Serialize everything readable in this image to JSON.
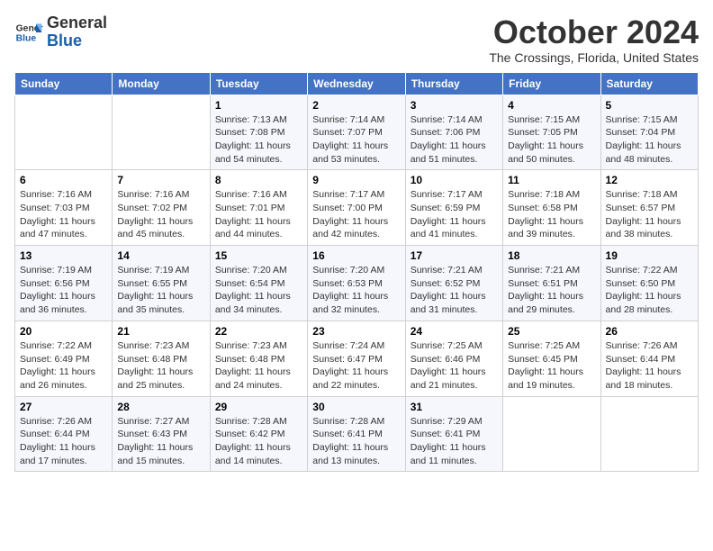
{
  "logo": {
    "general": "General",
    "blue": "Blue"
  },
  "title": "October 2024",
  "location": "The Crossings, Florida, United States",
  "headers": [
    "Sunday",
    "Monday",
    "Tuesday",
    "Wednesday",
    "Thursday",
    "Friday",
    "Saturday"
  ],
  "weeks": [
    [
      {
        "day": "",
        "info": ""
      },
      {
        "day": "",
        "info": ""
      },
      {
        "day": "1",
        "info": "Sunrise: 7:13 AM\nSunset: 7:08 PM\nDaylight: 11 hours and 54 minutes."
      },
      {
        "day": "2",
        "info": "Sunrise: 7:14 AM\nSunset: 7:07 PM\nDaylight: 11 hours and 53 minutes."
      },
      {
        "day": "3",
        "info": "Sunrise: 7:14 AM\nSunset: 7:06 PM\nDaylight: 11 hours and 51 minutes."
      },
      {
        "day": "4",
        "info": "Sunrise: 7:15 AM\nSunset: 7:05 PM\nDaylight: 11 hours and 50 minutes."
      },
      {
        "day": "5",
        "info": "Sunrise: 7:15 AM\nSunset: 7:04 PM\nDaylight: 11 hours and 48 minutes."
      }
    ],
    [
      {
        "day": "6",
        "info": "Sunrise: 7:16 AM\nSunset: 7:03 PM\nDaylight: 11 hours and 47 minutes."
      },
      {
        "day": "7",
        "info": "Sunrise: 7:16 AM\nSunset: 7:02 PM\nDaylight: 11 hours and 45 minutes."
      },
      {
        "day": "8",
        "info": "Sunrise: 7:16 AM\nSunset: 7:01 PM\nDaylight: 11 hours and 44 minutes."
      },
      {
        "day": "9",
        "info": "Sunrise: 7:17 AM\nSunset: 7:00 PM\nDaylight: 11 hours and 42 minutes."
      },
      {
        "day": "10",
        "info": "Sunrise: 7:17 AM\nSunset: 6:59 PM\nDaylight: 11 hours and 41 minutes."
      },
      {
        "day": "11",
        "info": "Sunrise: 7:18 AM\nSunset: 6:58 PM\nDaylight: 11 hours and 39 minutes."
      },
      {
        "day": "12",
        "info": "Sunrise: 7:18 AM\nSunset: 6:57 PM\nDaylight: 11 hours and 38 minutes."
      }
    ],
    [
      {
        "day": "13",
        "info": "Sunrise: 7:19 AM\nSunset: 6:56 PM\nDaylight: 11 hours and 36 minutes."
      },
      {
        "day": "14",
        "info": "Sunrise: 7:19 AM\nSunset: 6:55 PM\nDaylight: 11 hours and 35 minutes."
      },
      {
        "day": "15",
        "info": "Sunrise: 7:20 AM\nSunset: 6:54 PM\nDaylight: 11 hours and 34 minutes."
      },
      {
        "day": "16",
        "info": "Sunrise: 7:20 AM\nSunset: 6:53 PM\nDaylight: 11 hours and 32 minutes."
      },
      {
        "day": "17",
        "info": "Sunrise: 7:21 AM\nSunset: 6:52 PM\nDaylight: 11 hours and 31 minutes."
      },
      {
        "day": "18",
        "info": "Sunrise: 7:21 AM\nSunset: 6:51 PM\nDaylight: 11 hours and 29 minutes."
      },
      {
        "day": "19",
        "info": "Sunrise: 7:22 AM\nSunset: 6:50 PM\nDaylight: 11 hours and 28 minutes."
      }
    ],
    [
      {
        "day": "20",
        "info": "Sunrise: 7:22 AM\nSunset: 6:49 PM\nDaylight: 11 hours and 26 minutes."
      },
      {
        "day": "21",
        "info": "Sunrise: 7:23 AM\nSunset: 6:48 PM\nDaylight: 11 hours and 25 minutes."
      },
      {
        "day": "22",
        "info": "Sunrise: 7:23 AM\nSunset: 6:48 PM\nDaylight: 11 hours and 24 minutes."
      },
      {
        "day": "23",
        "info": "Sunrise: 7:24 AM\nSunset: 6:47 PM\nDaylight: 11 hours and 22 minutes."
      },
      {
        "day": "24",
        "info": "Sunrise: 7:25 AM\nSunset: 6:46 PM\nDaylight: 11 hours and 21 minutes."
      },
      {
        "day": "25",
        "info": "Sunrise: 7:25 AM\nSunset: 6:45 PM\nDaylight: 11 hours and 19 minutes."
      },
      {
        "day": "26",
        "info": "Sunrise: 7:26 AM\nSunset: 6:44 PM\nDaylight: 11 hours and 18 minutes."
      }
    ],
    [
      {
        "day": "27",
        "info": "Sunrise: 7:26 AM\nSunset: 6:44 PM\nDaylight: 11 hours and 17 minutes."
      },
      {
        "day": "28",
        "info": "Sunrise: 7:27 AM\nSunset: 6:43 PM\nDaylight: 11 hours and 15 minutes."
      },
      {
        "day": "29",
        "info": "Sunrise: 7:28 AM\nSunset: 6:42 PM\nDaylight: 11 hours and 14 minutes."
      },
      {
        "day": "30",
        "info": "Sunrise: 7:28 AM\nSunset: 6:41 PM\nDaylight: 11 hours and 13 minutes."
      },
      {
        "day": "31",
        "info": "Sunrise: 7:29 AM\nSunset: 6:41 PM\nDaylight: 11 hours and 11 minutes."
      },
      {
        "day": "",
        "info": ""
      },
      {
        "day": "",
        "info": ""
      }
    ]
  ]
}
